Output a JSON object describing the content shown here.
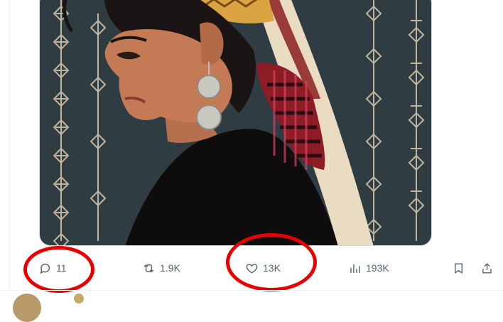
{
  "media": {
    "alt_icon": "illustration-of-woman-in-headscarf"
  },
  "actions": {
    "reply": {
      "icon": "reply-icon",
      "count": "11"
    },
    "repost": {
      "icon": "repost-icon",
      "count": "1.9K"
    },
    "like": {
      "icon": "heart-icon",
      "count": "13K"
    },
    "views": {
      "icon": "views-icon",
      "count": "193K"
    },
    "bookmark": {
      "icon": "bookmark-icon"
    },
    "share": {
      "icon": "share-icon"
    }
  },
  "colors": {
    "icon_gray": "#536471",
    "annotation_red": "#e60000",
    "media_background": "#2f3c41"
  }
}
